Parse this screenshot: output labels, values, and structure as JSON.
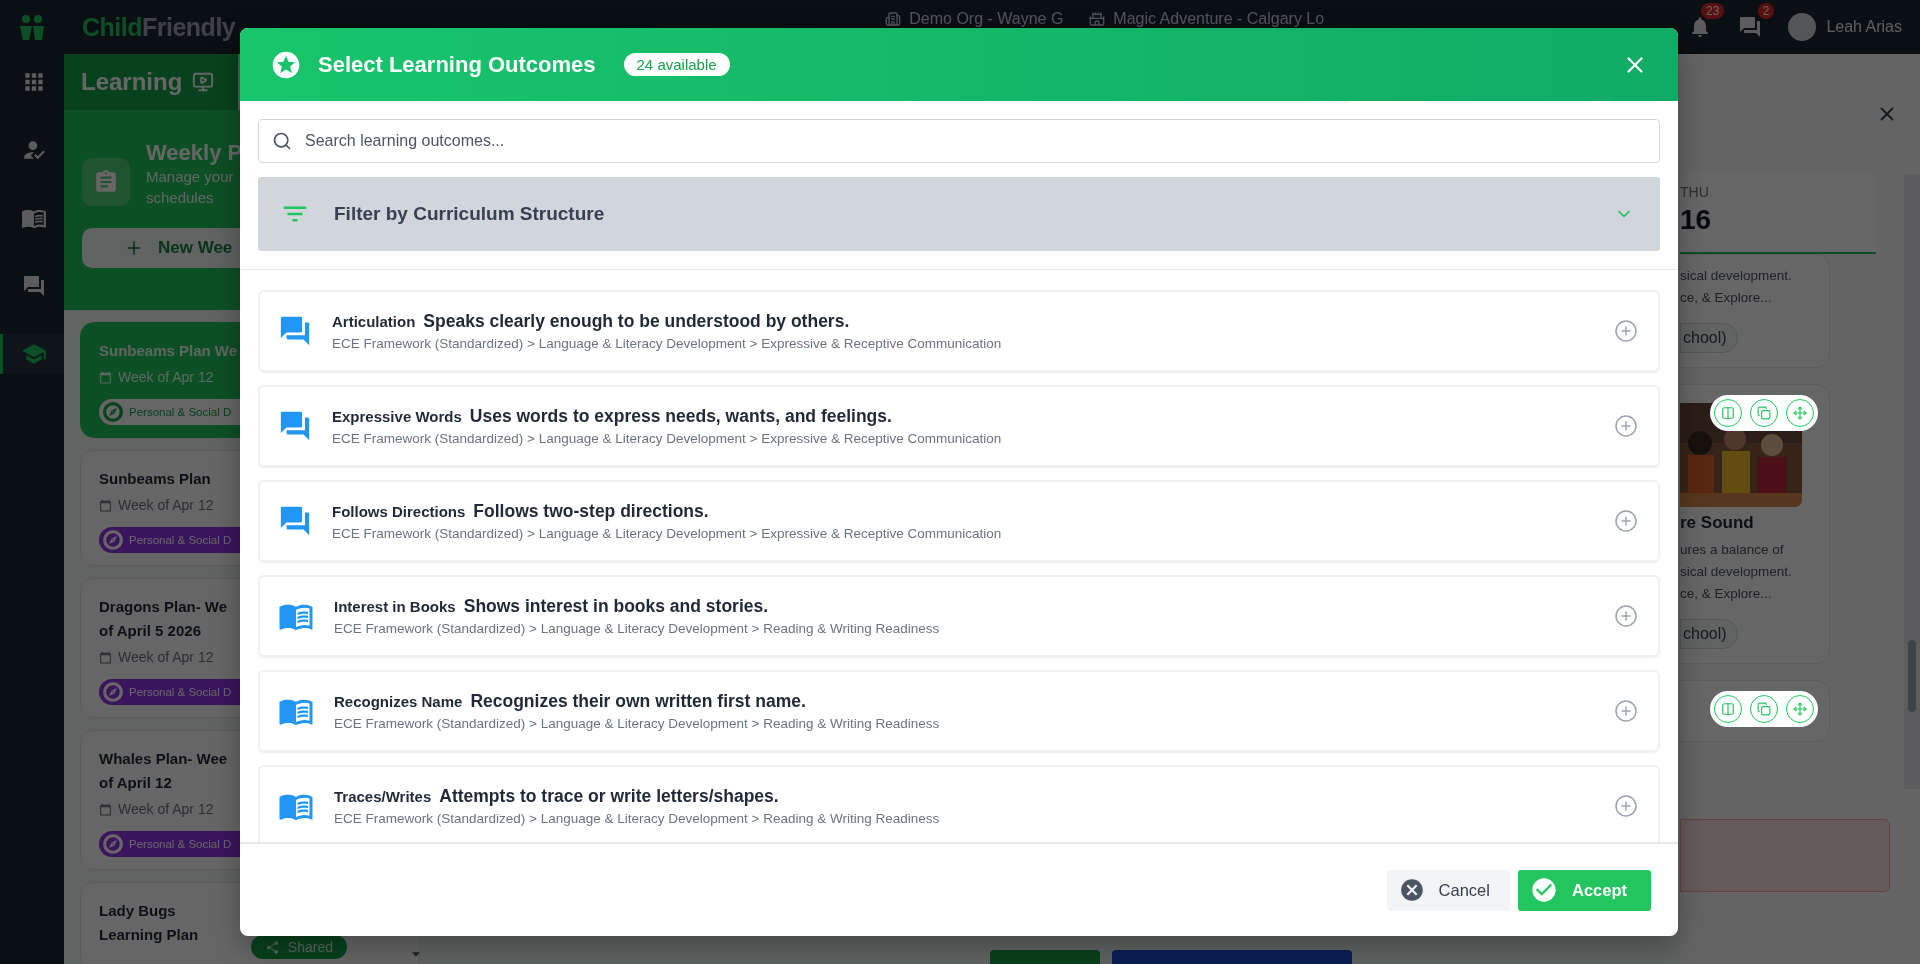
{
  "top_bar": {
    "brand_first": "Child",
    "brand_second": "Friendly",
    "org": "Demo Org - Wayne G",
    "location": "Magic Adventure - Calgary Lo",
    "notifications": "23",
    "messages": "2",
    "user": "Leah Arias"
  },
  "nav_rail": [
    {
      "kind": "apps",
      "selected": false
    },
    {
      "kind": "attendance",
      "selected": false
    },
    {
      "kind": "book",
      "selected": false
    },
    {
      "kind": "chat",
      "selected": false
    },
    {
      "kind": "learning",
      "selected": true
    }
  ],
  "learning_panel": {
    "title": "Learning",
    "heading": "Weekly P",
    "subtitle_lines": [
      "Manage your",
      "schedules"
    ],
    "new_button": "New Wee",
    "plans": [
      {
        "title_lines": [
          "Sunbeams Plan We"
        ],
        "week": "Week of Apr 12",
        "tag": "Personal & Social D",
        "selected": true
      },
      {
        "title_lines": [
          "Sunbeams Plan"
        ],
        "week": "Week of Apr 12",
        "tag": "Personal & Social D",
        "selected": false
      },
      {
        "title_lines": [
          "Dragons Plan- We",
          "of April 5 2026"
        ],
        "week": "Week of Apr 12",
        "tag": "Personal & Social D",
        "selected": false
      },
      {
        "title_lines": [
          "Whales Plan- Wee",
          "of April 12"
        ],
        "week": "Week of Apr 12",
        "tag": "Personal & Social D",
        "selected": false
      },
      {
        "title_lines": [
          "Lady Bugs",
          "Learning Plan"
        ],
        "shared": "Shared",
        "selected": false
      }
    ]
  },
  "day_panel": {
    "day": "THU",
    "date": "16",
    "cards": [
      {
        "lines": [
          "sical development.",
          "ce, & Explore..."
        ],
        "chip": "chool)"
      },
      {
        "kind": "picture",
        "title": "re Sound",
        "lines": [
          "ures a balance of",
          "sical development.",
          "ce, & Explore..."
        ],
        "chip": "chool)"
      },
      {
        "kind": "actions"
      }
    ]
  },
  "modal": {
    "title": "Select Learning Outcomes",
    "badge": "24 available",
    "search": {
      "placeholder": "Search learning outcomes..."
    },
    "filter": {
      "title": "Filter by Curriculum Structure",
      "expanded": false
    },
    "outcomes": [
      {
        "kind": "communication",
        "name": "Articulation",
        "description": "Speaks clearly enough to be understood by others.",
        "path": "ECE Framework (Standardized) > Language & Literacy Development > Expressive & Receptive Communication"
      },
      {
        "kind": "communication",
        "name": "Expressive Words",
        "description": "Uses words to express needs, wants, and feelings.",
        "path": "ECE Framework (Standardized) > Language & Literacy Development > Expressive & Receptive Communication"
      },
      {
        "kind": "communication",
        "name": "Follows Directions",
        "description": "Follows two-step directions.",
        "path": "ECE Framework (Standardized) > Language & Literacy Development > Expressive & Receptive Communication"
      },
      {
        "kind": "reading",
        "name": "Interest in Books",
        "description": "Shows interest in books and stories.",
        "path": "ECE Framework (Standardized) > Language & Literacy Development > Reading & Writing Readiness"
      },
      {
        "kind": "reading",
        "name": "Recognizes Name",
        "description": "Recognizes their own written first name.",
        "path": "ECE Framework (Standardized) > Language & Literacy Development > Reading & Writing Readiness"
      },
      {
        "kind": "reading",
        "name": "Traces/Writes",
        "description": "Attempts to trace or write letters/shapes.",
        "path": "ECE Framework (Standardized) > Language & Literacy Development > Reading & Writing Readiness"
      }
    ],
    "buttons": {
      "cancel": "Cancel",
      "accept": "Accept"
    }
  }
}
